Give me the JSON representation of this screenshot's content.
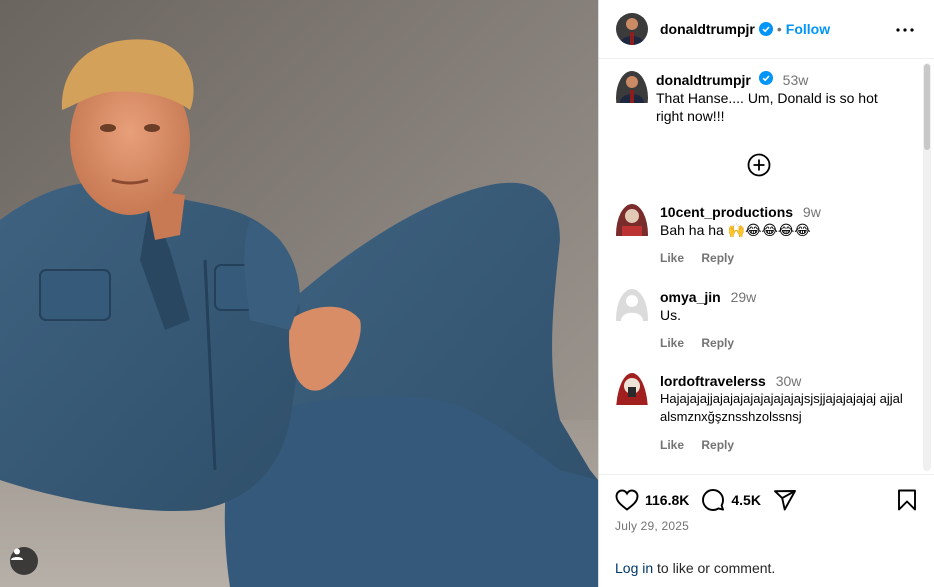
{
  "post": {
    "author": "donaldtrumpjr",
    "follow_label": "Follow",
    "dot": "•",
    "caption_time": "53w",
    "caption_text": "That Hanse.... Um, Donald is so hot right now!!!"
  },
  "comments": [
    {
      "user": "10cent_productions",
      "time": "9w",
      "text": "Bah ha ha 🙌😂😂😂😂",
      "like": "Like",
      "reply": "Reply"
    },
    {
      "user": "omya_jin",
      "time": "29w",
      "text": "Us.",
      "like": "Like",
      "reply": "Reply"
    },
    {
      "user": "lordoftravelerss",
      "time": "30w",
      "text": "Hajajajajjajajajajajajajajajsjsjjajajajajaj ajjalalsmznxğşznsshzolssnsj",
      "like": "Like",
      "reply": "Reply"
    }
  ],
  "stats": {
    "likes": "116.8K",
    "comments": "4.5K"
  },
  "date": "July 29, 2025",
  "login": {
    "link": "Log in",
    "rest": " to like or comment."
  },
  "icons": {
    "verified": "verified-badge-icon",
    "more": "more-options-icon",
    "add": "load-more-comments-icon",
    "like": "heart-icon",
    "comment": "comment-icon",
    "share": "share-icon",
    "save": "bookmark-icon",
    "tag": "user-tag-icon"
  },
  "colors": {
    "link": "#0095f6",
    "verified": "#0095f6",
    "muted": "#737373"
  }
}
